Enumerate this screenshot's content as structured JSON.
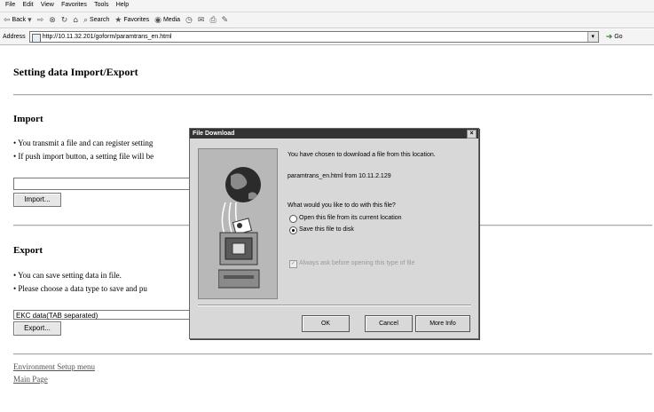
{
  "browser": {
    "menu": [
      "File",
      "Edit",
      "View",
      "Favorites",
      "Tools",
      "Help"
    ],
    "toolbar": {
      "back": "Back",
      "search": "Search",
      "favorites": "Favorites",
      "media": "Media"
    },
    "address_label": "Address",
    "address_url": "http://10.11.32.201/goform/paramtrans_en.html",
    "go_label": "Go"
  },
  "page": {
    "title": "Setting data Import/Export",
    "import": {
      "heading": "Import",
      "bullet1": "You transmit a file and can register setting",
      "bullet2": "If push import button, a setting file will be",
      "button": "Import..."
    },
    "export": {
      "heading": "Export",
      "bullet1": "You can save setting data in file.",
      "bullet2": "Please choose a data type to save and pu",
      "select_value": "EKC data(TAB separated)",
      "button": "Export..."
    },
    "links": {
      "env_setup": "Environment Setup menu",
      "main_page": "Main Page"
    }
  },
  "dialog": {
    "title": "File Download",
    "line1": "You have chosen to download a file from this location.",
    "file": "paramtrans_en.html from 10.11.2.129",
    "question": "What would you like to do with this file?",
    "option_open": "Open this file from its current location",
    "option_save": "Save this file to disk",
    "always_ask": "Always ask before opening this type of file",
    "ok": "OK",
    "cancel": "Cancel",
    "more_info": "More Info"
  },
  "icons": {
    "back": "back-arrow-icon",
    "forward": "forward-arrow-icon",
    "stop": "stop-icon",
    "refresh": "refresh-icon",
    "home": "home-icon",
    "search": "search-icon",
    "favorites": "favorites-icon",
    "media": "media-icon",
    "history": "history-icon",
    "mail": "mail-icon",
    "print": "print-icon",
    "edit": "edit-icon",
    "go": "go-arrow-icon",
    "globe": "globe-icon",
    "computer": "computer-icon"
  }
}
